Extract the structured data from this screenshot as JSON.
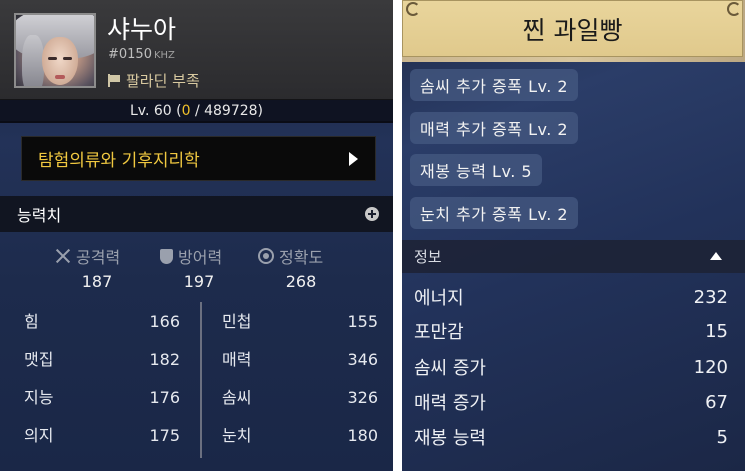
{
  "character": {
    "name": "샤누아",
    "id": "#0150",
    "id_unit": "KHZ",
    "guild": "팔라딘 부족",
    "level_prefix": "Lv. 60 (",
    "exp_current": "0",
    "exp_rest": " / 489728)"
  },
  "explore": {
    "label": "탐험의류와 기후지리학"
  },
  "stats": {
    "header": "능력치",
    "combat": [
      {
        "label": "공격력",
        "value": "187",
        "icon": "sword-icon"
      },
      {
        "label": "방어력",
        "value": "197",
        "icon": "shield-icon"
      },
      {
        "label": "정확도",
        "value": "268",
        "icon": "target-icon"
      }
    ],
    "attributes_left": [
      {
        "label": "힘",
        "value": "166"
      },
      {
        "label": "맷집",
        "value": "182"
      },
      {
        "label": "지능",
        "value": "176"
      },
      {
        "label": "의지",
        "value": "175"
      }
    ],
    "attributes_right": [
      {
        "label": "민첩",
        "value": "155"
      },
      {
        "label": "매력",
        "value": "346"
      },
      {
        "label": "솜씨",
        "value": "326"
      },
      {
        "label": "눈치",
        "value": "180"
      }
    ]
  },
  "item": {
    "title": "찐 과일빵",
    "buffs": [
      "솜씨 추가 증폭 Lv. 2",
      "매력 추가 증폭 Lv. 2",
      "재봉 능력 Lv. 5",
      "눈치 추가 증폭 Lv. 2"
    ],
    "info_header": "정보",
    "info": [
      {
        "label": "에너지",
        "value": "232"
      },
      {
        "label": "포만감",
        "value": "15"
      },
      {
        "label": "솜씨 증가",
        "value": "120"
      },
      {
        "label": "매력 증가",
        "value": "67"
      },
      {
        "label": "재봉 능력",
        "value": "5"
      }
    ]
  },
  "colors": {
    "accent_gold": "#f0c840",
    "exp_yellow": "#f0c02a",
    "title_plate": "#e9d59c"
  }
}
